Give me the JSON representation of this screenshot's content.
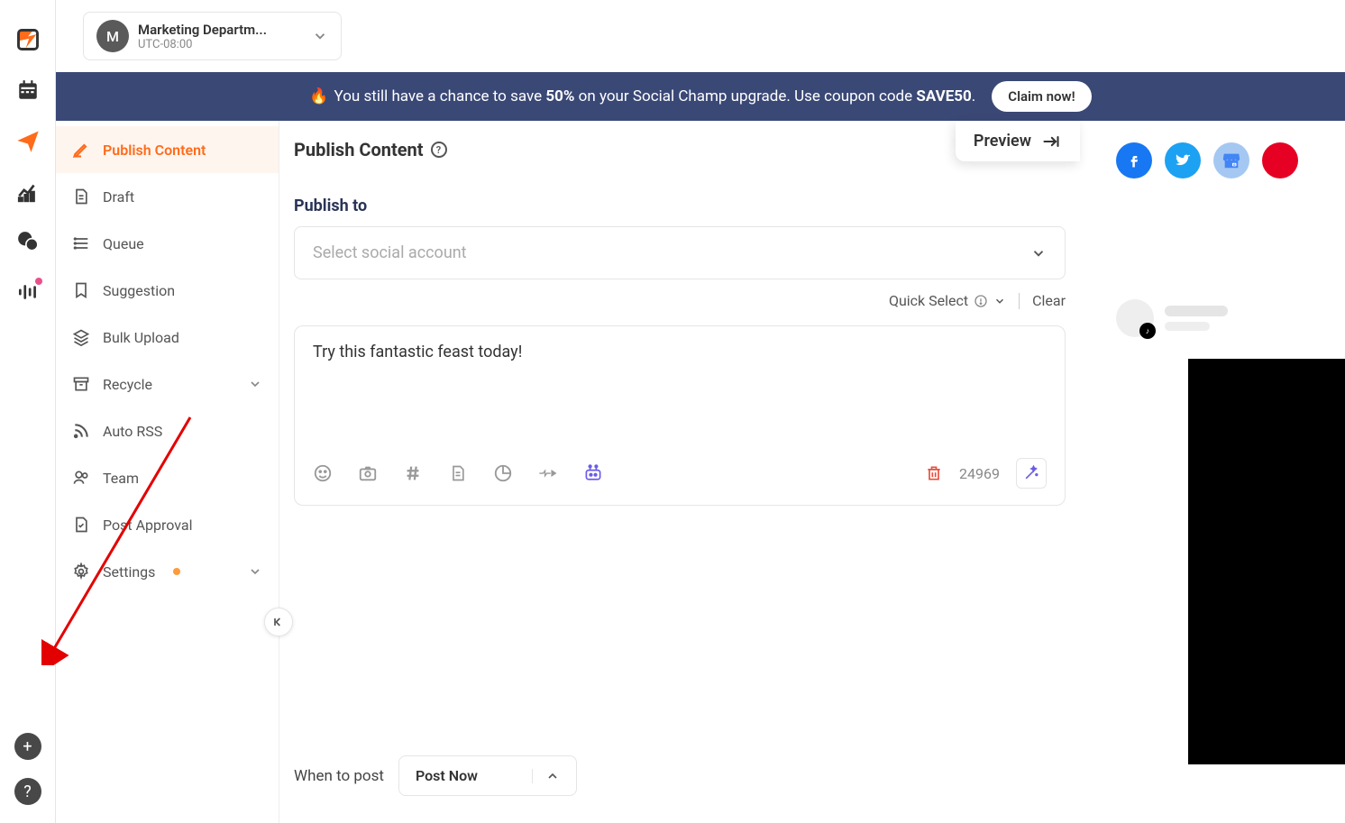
{
  "workspace": {
    "avatar_letter": "M",
    "name": "Marketing Departm...",
    "timezone": "UTC-08:00"
  },
  "banner": {
    "prefix": "You still have a chance to save ",
    "percent": "50%",
    "middle": " on your Social Champ upgrade. Use coupon code ",
    "code": "SAVE50",
    "suffix": ".",
    "claim": "Claim now!"
  },
  "sidebar": {
    "items": [
      {
        "label": "Publish Content"
      },
      {
        "label": "Draft"
      },
      {
        "label": "Queue"
      },
      {
        "label": "Suggestion"
      },
      {
        "label": "Bulk Upload"
      },
      {
        "label": "Recycle"
      },
      {
        "label": "Auto RSS"
      },
      {
        "label": "Team"
      },
      {
        "label": "Post Approval"
      },
      {
        "label": "Settings"
      }
    ]
  },
  "main": {
    "title": "Publish Content",
    "preview_label": "Preview",
    "publish_to_label": "Publish to",
    "account_placeholder": "Select social account",
    "quick_select": "Quick Select",
    "clear": "Clear",
    "composer_text": "Try this fantastic feast today!",
    "char_count": "24969",
    "when_label": "When to post",
    "post_now": "Post Now"
  }
}
